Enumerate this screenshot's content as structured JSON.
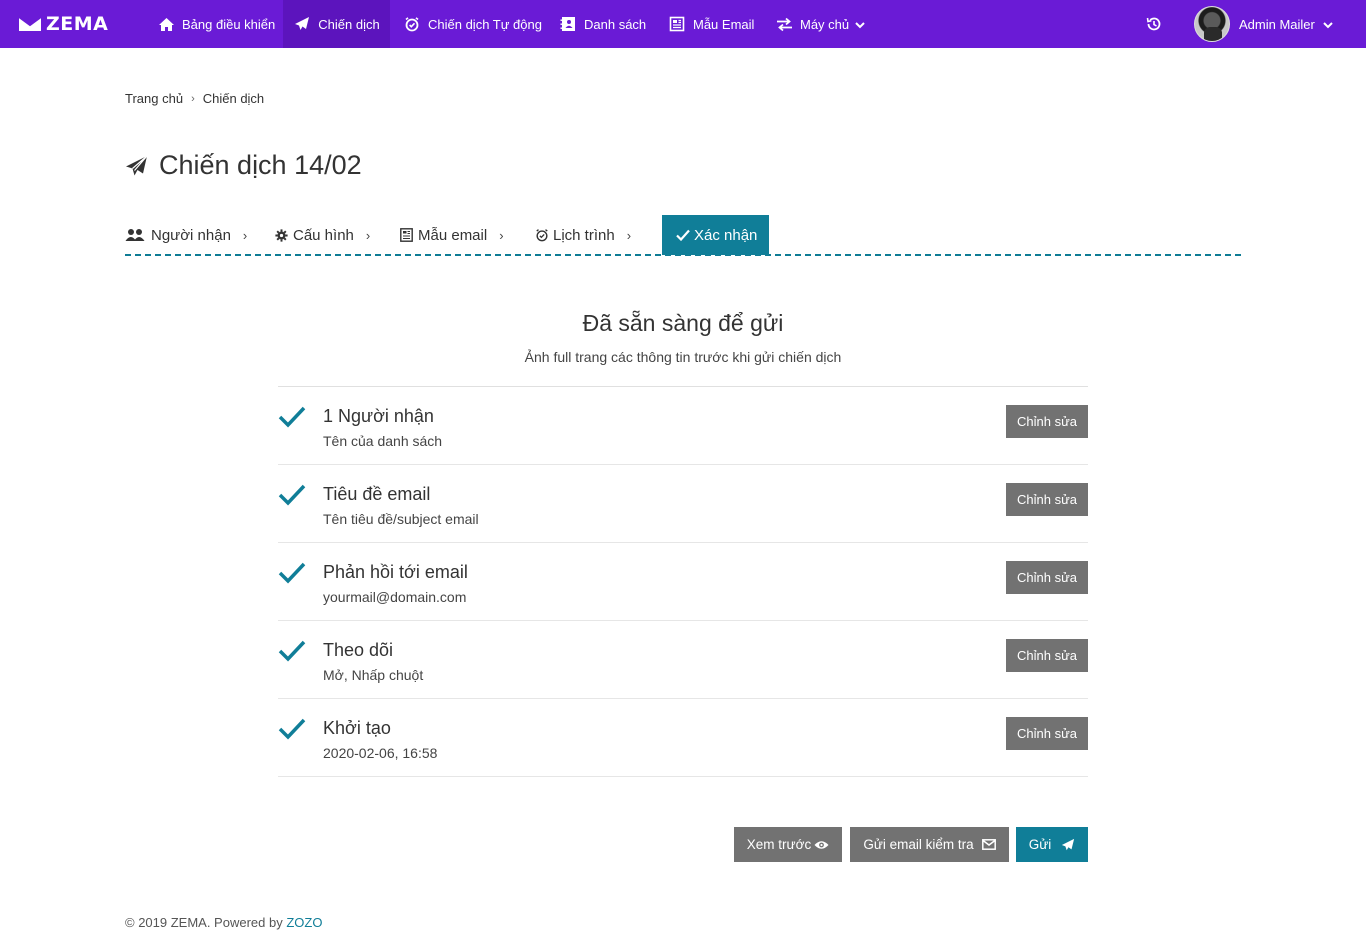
{
  "brand": {
    "name": "ZEMA"
  },
  "nav": {
    "items": [
      {
        "label": "Bảng điều khiển",
        "icon": "home-icon"
      },
      {
        "label": "Chiến dịch",
        "icon": "paper-plane-icon",
        "active": true
      },
      {
        "label": "Chiến dịch Tự động",
        "icon": "alarm-clock-icon"
      },
      {
        "label": "Danh sách",
        "icon": "contact-book-icon"
      },
      {
        "label": "Mẫu Email",
        "icon": "newspaper-icon"
      },
      {
        "label": "Máy chủ",
        "icon": "exchange-icon"
      }
    ],
    "user_name": "Admin Mailer"
  },
  "breadcrumb": {
    "home": "Trang chủ",
    "current": "Chiến dịch"
  },
  "page": {
    "title": "Chiến dịch 14/02"
  },
  "steps": [
    {
      "label": "Người nhận",
      "icon": "users-icon"
    },
    {
      "label": "Cấu hình",
      "icon": "gear-icon"
    },
    {
      "label": "Mẫu email",
      "icon": "newspaper-icon"
    },
    {
      "label": "Lịch trình",
      "icon": "alarm-clock-icon"
    },
    {
      "label": "Xác nhận",
      "icon": "check-icon",
      "active": true
    }
  ],
  "ready": {
    "title": "Đã sẵn sàng để gửi",
    "subtitle": "Ảnh full trang các thông tin trước khi gửi chiến dịch"
  },
  "checklist": [
    {
      "title": "1 Người nhận",
      "subtitle": "Tên của danh sách",
      "button": "Chỉnh sửa"
    },
    {
      "title": "Tiêu đề email",
      "subtitle": "Tên tiêu đề/subject email",
      "button": "Chỉnh sửa"
    },
    {
      "title": "Phản hồi tới email",
      "subtitle": "yourmail@domain.com",
      "button": "Chỉnh sửa"
    },
    {
      "title": "Theo dõi",
      "subtitle": "Mở, Nhấp chuột",
      "button": "Chỉnh sửa"
    },
    {
      "title": "Khởi tạo",
      "subtitle": "2020-02-06, 16:58",
      "button": "Chỉnh sửa"
    }
  ],
  "actions": {
    "preview": "Xem trước",
    "test_email": "Gửi email kiểm tra",
    "send": "Gửi"
  },
  "footer": {
    "text": "© 2019 ZEMA. Powered by",
    "link": "ZOZO"
  },
  "colors": {
    "nav_bg": "#6a1bd6",
    "accent": "#107e98",
    "grey_button": "#727272"
  }
}
